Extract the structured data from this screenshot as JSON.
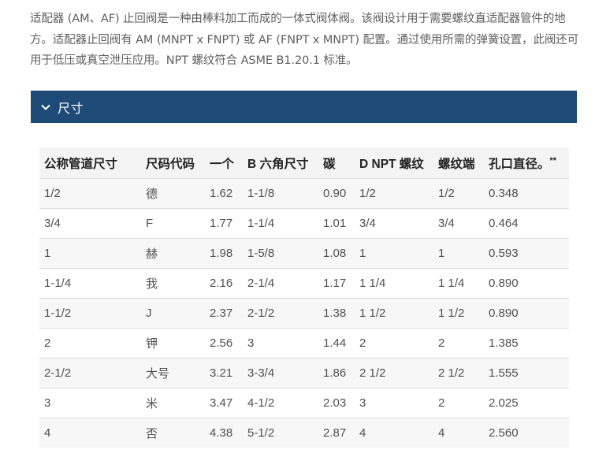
{
  "intro": {
    "text": "适配器 (AM、AF) 止回阀是一种由棒料加工而成的一体式阀体阀。该阀设计用于需要螺纹直适配器管件的地方。适配器止回阀有 AM (MNPT x FNPT) 或 AF (FNPT x MNPT) 配置。通过使用所需的弹簧设置，此阀还可用于低压或真空泄压应用。NPT 螺纹符合 ASME B1.20.1 标准。"
  },
  "accordion": {
    "title": "尺寸",
    "icon": "chevron-down-icon"
  },
  "table": {
    "headers": [
      "公称管道尺寸",
      "尺码代码",
      "一个",
      "B 六角尺寸",
      "碳",
      "D NPT 螺纹",
      "螺纹端",
      "孔口直径。"
    ],
    "header_suffix": "**",
    "rows": [
      [
        "1/2",
        "德",
        "1.62",
        "1-1/8",
        "0.90",
        "1/2",
        "1/2",
        "0.348"
      ],
      [
        "3/4",
        "F",
        "1.77",
        "1-1/4",
        "1.01",
        "3/4",
        "3/4",
        "0.464"
      ],
      [
        "1",
        "赫",
        "1.98",
        "1-5/8",
        "1.08",
        "1",
        "1",
        "0.593"
      ],
      [
        "1-1/4",
        "我",
        "2.16",
        "2-1/4",
        "1.17",
        "1 1/4",
        "1 1/4",
        "0.890"
      ],
      [
        "1-1/2",
        "J",
        "2.37",
        "2-1/2",
        "1.38",
        "1 1/2",
        "1 1/2",
        "0.890"
      ],
      [
        "2",
        "钾",
        "2.56",
        "3",
        "1.44",
        "2",
        "2",
        "1.385"
      ],
      [
        "2-1/2",
        "大号",
        "3.21",
        "3-3/4",
        "1.86",
        "2 1/2",
        "2 1/2",
        "1.555"
      ],
      [
        "3",
        "米",
        "3.47",
        "4-1/2",
        "2.03",
        "3",
        "2",
        "2.025"
      ],
      [
        "4",
        "否",
        "4.38",
        "5-1/2",
        "2.87",
        "4",
        "4",
        "2.560"
      ]
    ]
  },
  "colors": {
    "accordion_bg": "#1e4a78",
    "header_bg": "#f4f4f4",
    "stripe_bg": "#f7f7f7"
  }
}
